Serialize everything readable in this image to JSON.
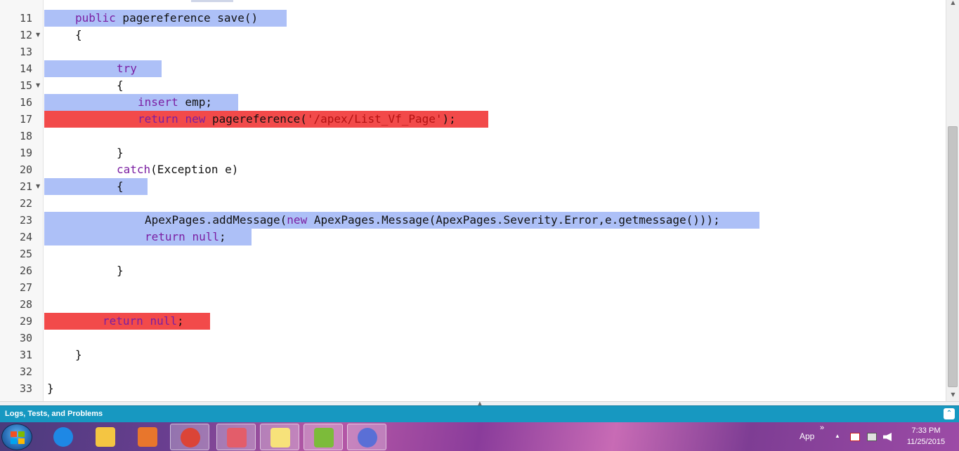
{
  "editor": {
    "lines": [
      {
        "num": "11",
        "fold": "",
        "indent": 44,
        "tokens": [
          {
            "t": "public",
            "c": "kw"
          },
          {
            "t": " pagereference save()",
            "c": ""
          }
        ],
        "highlight": {
          "type": "blue",
          "start": 0,
          "width": 345
        }
      },
      {
        "num": "12",
        "fold": "▼",
        "indent": 44,
        "tokens": [
          {
            "t": "{",
            "c": ""
          }
        ],
        "highlight": null
      },
      {
        "num": "13",
        "fold": "",
        "indent": 44,
        "tokens": [],
        "highlight": null
      },
      {
        "num": "14",
        "fold": "",
        "indent": 103,
        "tokens": [
          {
            "t": "try",
            "c": "kw"
          }
        ],
        "highlight": {
          "type": "blue",
          "start": 0,
          "width": 167
        }
      },
      {
        "num": "15",
        "fold": "▼",
        "indent": 103,
        "tokens": [
          {
            "t": "{",
            "c": ""
          }
        ],
        "highlight": null
      },
      {
        "num": "16",
        "fold": "",
        "indent": 133,
        "tokens": [
          {
            "t": "insert",
            "c": "kw"
          },
          {
            "t": " emp;",
            "c": ""
          }
        ],
        "highlight": {
          "type": "blue",
          "start": 0,
          "width": 276
        }
      },
      {
        "num": "17",
        "fold": "",
        "indent": 133,
        "tokens": [
          {
            "t": "return",
            "c": "kw"
          },
          {
            "t": " ",
            "c": ""
          },
          {
            "t": "new",
            "c": "kw"
          },
          {
            "t": " pagereference(",
            "c": ""
          },
          {
            "t": "'/apex/List_Vf_Page'",
            "c": "str"
          },
          {
            "t": ");",
            "c": ""
          }
        ],
        "highlight": {
          "type": "red",
          "start": 0,
          "width": 632
        }
      },
      {
        "num": "18",
        "fold": "",
        "indent": 103,
        "tokens": [],
        "highlight": null
      },
      {
        "num": "19",
        "fold": "",
        "indent": 103,
        "tokens": [
          {
            "t": "}",
            "c": ""
          }
        ],
        "highlight": null
      },
      {
        "num": "20",
        "fold": "",
        "indent": 103,
        "tokens": [
          {
            "t": "catch",
            "c": "kw"
          },
          {
            "t": "(Exception e)",
            "c": ""
          }
        ],
        "highlight": null
      },
      {
        "num": "21",
        "fold": "▼",
        "indent": 103,
        "tokens": [
          {
            "t": "{",
            "c": ""
          }
        ],
        "highlight": {
          "type": "blue",
          "start": 0,
          "width": 147
        }
      },
      {
        "num": "22",
        "fold": "",
        "indent": 103,
        "tokens": [],
        "highlight": null
      },
      {
        "num": "23",
        "fold": "",
        "indent": 143,
        "tokens": [
          {
            "t": "ApexPages.addMessage(",
            "c": ""
          },
          {
            "t": "new",
            "c": "kw"
          },
          {
            "t": " ApexPages.Message(ApexPages.Severity.Error,e.getmessage()));",
            "c": ""
          }
        ],
        "highlight": {
          "type": "blue",
          "start": 0,
          "width": 1018
        }
      },
      {
        "num": "24",
        "fold": "",
        "indent": 143,
        "tokens": [
          {
            "t": "return",
            "c": "kw"
          },
          {
            "t": " ",
            "c": ""
          },
          {
            "t": "null",
            "c": "kw"
          },
          {
            "t": ";",
            "c": ""
          }
        ],
        "highlight": {
          "type": "blue",
          "start": 0,
          "width": 295
        }
      },
      {
        "num": "25",
        "fold": "",
        "indent": 103,
        "tokens": [],
        "highlight": null
      },
      {
        "num": "26",
        "fold": "",
        "indent": 103,
        "tokens": [
          {
            "t": "}",
            "c": ""
          }
        ],
        "highlight": null
      },
      {
        "num": "27",
        "fold": "",
        "indent": 103,
        "tokens": [],
        "highlight": null
      },
      {
        "num": "28",
        "fold": "",
        "indent": 103,
        "tokens": [],
        "highlight": null
      },
      {
        "num": "29",
        "fold": "",
        "indent": 83,
        "tokens": [
          {
            "t": "return",
            "c": "kw"
          },
          {
            "t": " ",
            "c": ""
          },
          {
            "t": "null",
            "c": "kw"
          },
          {
            "t": ";",
            "c": ""
          }
        ],
        "highlight": {
          "type": "red",
          "start": 0,
          "width": 236
        }
      },
      {
        "num": "30",
        "fold": "",
        "indent": 44,
        "tokens": [],
        "highlight": null
      },
      {
        "num": "31",
        "fold": "",
        "indent": 44,
        "tokens": [
          {
            "t": "}",
            "c": ""
          }
        ],
        "highlight": null
      },
      {
        "num": "32",
        "fold": "",
        "indent": 4,
        "tokens": [],
        "highlight": null
      },
      {
        "num": "33",
        "fold": "",
        "indent": 4,
        "tokens": [
          {
            "t": "}",
            "c": ""
          }
        ],
        "highlight": null
      }
    ]
  },
  "panel": {
    "title": "Logs, Tests, and Problems",
    "toggle_icon": "double-chevron-up-icon"
  },
  "taskbar": {
    "apps": [
      {
        "name": "internet-explorer-icon",
        "color": "#1e88e5"
      },
      {
        "name": "file-explorer-icon",
        "color": "#f4c542"
      },
      {
        "name": "media-player-icon",
        "color": "#e8762c"
      },
      {
        "name": "chrome-icon",
        "color": "#db4437"
      },
      {
        "name": "snipping-tool-icon",
        "color": "#e35d6a"
      },
      {
        "name": "sticky-notes-icon",
        "color": "#f7e27a"
      },
      {
        "name": "notepad-plus-icon",
        "color": "#7cbb3a"
      },
      {
        "name": "torrent-client-icon",
        "color": "#5a6fd6"
      }
    ],
    "tray_label": "App",
    "tray_overflow": "»",
    "tray_arrow": "▲",
    "time": "7:33 PM",
    "date": "11/25/2015"
  },
  "colors": {
    "highlight_blue": "#adc0f7",
    "highlight_red": "#f24a4a",
    "keyword": "#7b1fa2",
    "string": "#b31212",
    "panel": "#1798c1"
  }
}
